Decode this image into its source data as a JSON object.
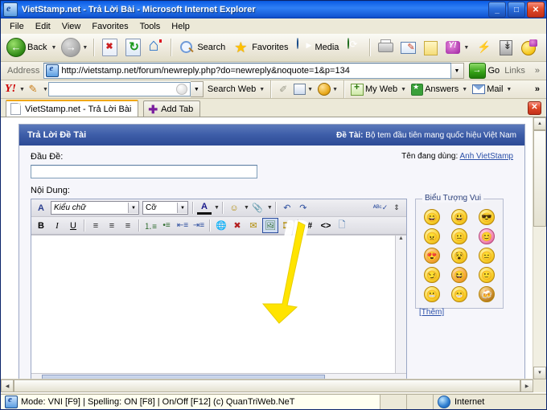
{
  "window": {
    "title": "VietStamp.net - Trả Lời Bài - Microsoft Internet Explorer",
    "minimize": "_",
    "maximize": "□",
    "close": "✕"
  },
  "menu": {
    "items": [
      "File",
      "Edit",
      "View",
      "Favorites",
      "Tools",
      "Help"
    ]
  },
  "toolbar": {
    "back": "Back",
    "search": "Search",
    "favorites": "Favorites",
    "media": "Media"
  },
  "address": {
    "label": "Address",
    "url": "http://vietstamp.net/forum/newreply.php?do=newreply&noquote=1&p=134",
    "go": "Go",
    "links": "Links",
    "chevron": "»"
  },
  "yahoo_bar": {
    "logo": "Y!",
    "search_value": "",
    "search_web": "Search Web",
    "my_web": "My Web",
    "answers": "Answers",
    "mail": "Mail",
    "overflow": "»"
  },
  "tabs": {
    "active_tab": "VietStamp.net - Trả Lời Bài",
    "add_tab": "Add Tab",
    "close": "✕"
  },
  "page": {
    "header_left": "Trả Lời Đề Tài",
    "header_right_label": "Đề Tài:",
    "header_right_value": " Bộ tem đầu tiên mang quốc hiệu Việt Nam",
    "subject_label": "Đầu Đề:",
    "subject_value": "",
    "username_label": "Tên đang dùng:",
    "username_value": "Anh VietStamp",
    "message_label": "Nội Dung:",
    "message_value": "",
    "editor": {
      "font_family": "Kiểu chữ",
      "font_size": "Cỡ",
      "row1": [
        "font-style-icon",
        "font-family-select",
        "font-size-select",
        "font-color-icon",
        "smiley-icon",
        "attach-icon",
        "undo-icon",
        "redo-icon",
        "spellcheck-icon",
        "resize-icon"
      ],
      "row2": [
        "bold-icon",
        "italic-icon",
        "underline-icon",
        "align-left-icon",
        "align-center-icon",
        "align-right-icon",
        "ordered-list-icon",
        "unordered-list-icon",
        "outdent-icon",
        "indent-icon",
        "insert-link-icon",
        "remove-link-icon",
        "insert-email-icon",
        "insert-image-icon",
        "insert-video-icon",
        "insert-code-icon",
        "insert-html-icon",
        "insert-quote-icon"
      ],
      "selected_button": "insert-image-icon",
      "bold": "B",
      "italic": "I",
      "underline": "U",
      "hash": "#",
      "code": "<>"
    },
    "smilies": {
      "title": "Biểu Tượng Vui",
      "more_link": "[Thêm]",
      "glyphs": [
        "😄",
        "😃",
        "😎",
        "😠",
        "😐",
        "😊",
        "😍",
        "😵",
        "😑",
        "😏",
        "😆",
        "🙂",
        "😬",
        "😁",
        "🍻"
      ]
    }
  },
  "statusbar": {
    "message": "Mode: VNI [F9] | Spelling: ON [F8] | On/Off [F12] (c) QuanTriWeb.NeT",
    "zone": "Internet"
  },
  "annotation": {
    "type": "yellow-arrow",
    "color": "#ffe400",
    "points_to": "insert-image-icon"
  }
}
